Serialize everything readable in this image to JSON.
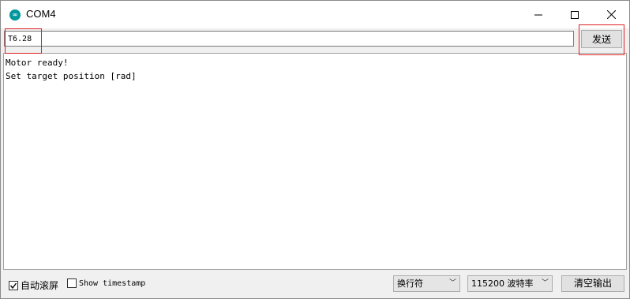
{
  "window": {
    "title": "COM4",
    "icon": "arduino-infinity-icon"
  },
  "input": {
    "value": "T6.28",
    "send_label": "发送"
  },
  "output": {
    "lines": [
      "Motor ready!",
      "Set target position [rad]"
    ]
  },
  "statusbar": {
    "autoscroll_label": "自动滚屏",
    "autoscroll_checked": true,
    "timestamp_label": "Show timestamp",
    "timestamp_checked": false,
    "line_ending": "换行符",
    "baud_rate": "115200 波特率",
    "clear_label": "清空输出"
  },
  "colors": {
    "highlight": "#e02020",
    "arduino_teal": "#00979c"
  }
}
